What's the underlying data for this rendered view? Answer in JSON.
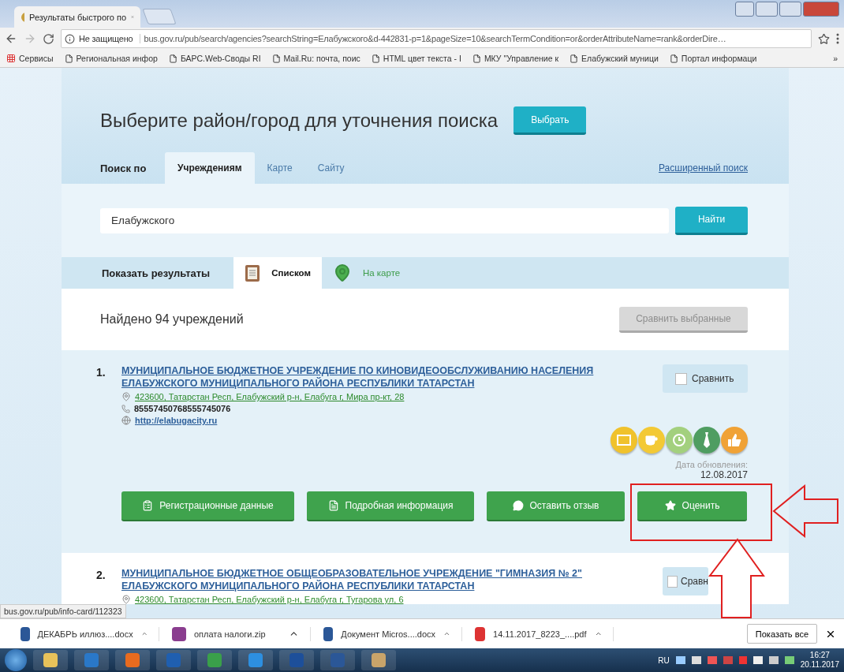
{
  "browser": {
    "tab_title": "Результаты быстрого по",
    "security": "Не защищено",
    "url": "bus.gov.ru/pub/search/agencies?searchString=Елабужского&d-442831-p=1&pageSize=10&searchTermCondition=or&orderAttributeName=rank&orderDire…",
    "bookmarks": [
      "Сервисы",
      "Региональная инфор",
      "БАРС.Web-Своды RI",
      "Mail.Ru: почта, поис",
      "HTML цвет текста - I",
      "МКУ \"Управление к",
      "Елабужский муници",
      "Портал информаци"
    ],
    "bookmarks_more": "»"
  },
  "region": {
    "heading": "Выберите район/город для уточнения поиска",
    "button": "Выбрать"
  },
  "search": {
    "label": "Поиск по",
    "tabs": [
      {
        "label": "Учреждениям",
        "selected": true
      },
      {
        "label": "Карте",
        "selected": false
      },
      {
        "label": "Сайту",
        "selected": false
      }
    ],
    "advanced": "Расширенный поиск",
    "value": "Елабужского",
    "button": "Найти"
  },
  "view": {
    "label": "Показать результаты",
    "options": [
      {
        "label": "Списком",
        "kind": "list",
        "selected": true
      },
      {
        "label": "На карте",
        "kind": "map",
        "selected": false
      }
    ]
  },
  "found": "Найдено 94 учреждений",
  "compare_selected": {
    "label": "Сравнить выбранные",
    "disabled": true
  },
  "results": [
    {
      "number": "1.",
      "title": "МУНИЦИПАЛЬНОЕ БЮДЖЕТНОЕ УЧРЕЖДЕНИЕ ПО КИНОВИДЕООБСЛУЖИВАНИЮ НАСЕЛЕНИЯ ЕЛАБУЖСКОГО МУНИЦИПАЛЬНОГО РАЙОНА РЕСПУБЛИКИ ТАТАРСТАН",
      "address": "423600, Татарстан Респ, Елабужский р-н, Елабуга г, Мира пр-кт, 28",
      "phone": "85557450768555745076",
      "site": "http://elabugacity.ru",
      "compare": {
        "label": "Сравнить",
        "checked": false
      },
      "badges": [
        {
          "kind": "tray",
          "color": "#f0c22c"
        },
        {
          "kind": "cup",
          "color": "#f3c935"
        },
        {
          "kind": "clock",
          "color": "#a3d07e"
        },
        {
          "kind": "tie",
          "color": "#4f9d61"
        },
        {
          "kind": "thumb",
          "color": "#f0a236"
        }
      ],
      "updated_label": "Дата обновления:",
      "updated": "12.08.2017",
      "actions": [
        {
          "kind": "card",
          "label": "Регистрационные данные"
        },
        {
          "kind": "info",
          "label": "Подробная информация"
        },
        {
          "kind": "comment",
          "label": "Оставить отзыв"
        },
        {
          "kind": "star",
          "label": "Оценить"
        }
      ]
    },
    {
      "number": "2.",
      "title": "МУНИЦИПАЛЬНОЕ БЮДЖЕТНОЕ ОБЩЕОБРАЗОВАТЕЛЬНОЕ УЧРЕЖДЕНИЕ \"ГИМНАЗИЯ № 2\" ЕЛАБУЖСКОГО МУНИЦИПАЛЬНОГО РАЙОНА РЕСПУБЛИКИ ТАТАРСТАН",
      "address": "423600, Татарстан Респ, Елабужский р-н, Елабуга г, Тугарова ул, 6",
      "compare": {
        "label": "Сравн",
        "checked": false
      }
    }
  ],
  "status_url": "bus.gov.ru/pub/info-card/112323",
  "downloads": [
    {
      "name": "ДЕКАБРЬ иллюз....docx",
      "kind": "word"
    },
    {
      "name": "оплата налоги.zip",
      "kind": "zip"
    },
    {
      "name": "Документ Micros....docx",
      "kind": "word"
    },
    {
      "name": "14.11.2017_8223_....pdf",
      "kind": "pdf"
    }
  ],
  "show_all": "Показать все",
  "taskbar": {
    "language": "RU",
    "time": "16:27",
    "date": "20.11.2017"
  }
}
